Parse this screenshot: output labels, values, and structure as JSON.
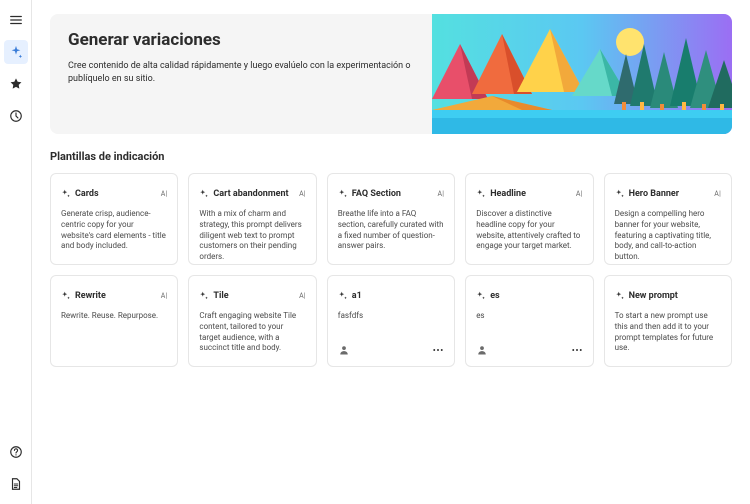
{
  "sidebar": {
    "items": [
      {
        "name": "menu-icon",
        "glyph": "hamburger",
        "active": false
      },
      {
        "name": "generate-icon",
        "glyph": "sparkle",
        "active": true
      },
      {
        "name": "favorites-icon",
        "glyph": "star",
        "active": false
      },
      {
        "name": "history-icon",
        "glyph": "clock",
        "active": false
      }
    ],
    "bottom": [
      {
        "name": "help-icon",
        "glyph": "help"
      },
      {
        "name": "document-icon",
        "glyph": "doc"
      }
    ]
  },
  "hero": {
    "title": "Generar variaciones",
    "subtitle": "Cree contenido de alta calidad rápidamente y luego evalúelo con la experimentación o publíquelo en su sitio."
  },
  "section_title": "Plantillas de indicación",
  "badge_label": "A|",
  "cards": [
    {
      "title": "Cards",
      "desc": "Generate crisp, audience-centric copy for your website's card elements - title and body included.",
      "badge": true,
      "footer": false
    },
    {
      "title": "Cart abandonment",
      "desc": "With a mix of charm and strategy, this prompt delivers diligent web text to prompt customers on their pending orders.",
      "badge": true,
      "footer": false
    },
    {
      "title": "FAQ Section",
      "desc": "Breathe life into a FAQ section, carefully curated with a fixed number of question-answer pairs.",
      "badge": true,
      "footer": false
    },
    {
      "title": "Headline",
      "desc": "Discover a distinctive headline copy for your website, attentively crafted to engage your target market.",
      "badge": true,
      "footer": false
    },
    {
      "title": "Hero Banner",
      "desc": "Design a compelling hero banner for your website, featuring a captivating title, body, and call-to-action button.",
      "badge": true,
      "footer": false
    },
    {
      "title": "Rewrite",
      "desc": "Rewrite. Reuse. Repurpose.",
      "badge": true,
      "footer": false
    },
    {
      "title": "Tile",
      "desc": "Craft engaging website Tile content, tailored to your target audience, with a succinct title and body.",
      "badge": true,
      "footer": false
    },
    {
      "title": "a1",
      "desc": "fasfdfs",
      "badge": false,
      "footer": true
    },
    {
      "title": "es",
      "desc": "es",
      "badge": false,
      "footer": true
    },
    {
      "title": "New prompt",
      "desc": "To start a new prompt use this and then add it to your prompt templates for future use.",
      "badge": false,
      "footer": false
    }
  ]
}
